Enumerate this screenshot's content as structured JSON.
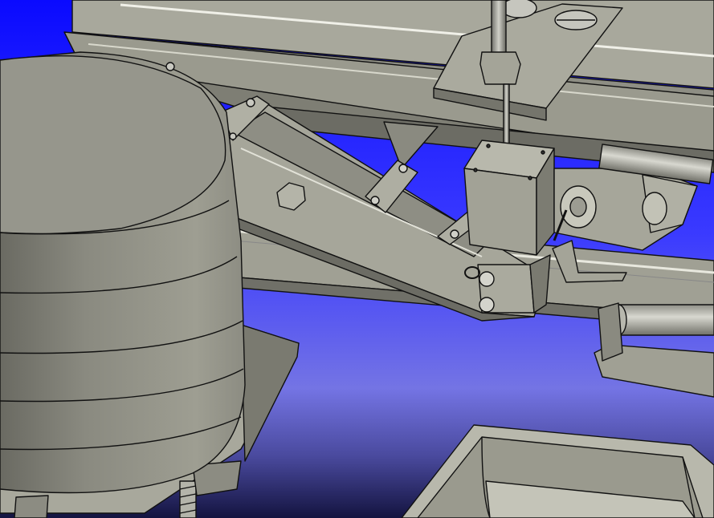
{
  "viewport": {
    "description_free": true,
    "colors": {
      "background_top": "#1010ff",
      "background_mid": "#7070e0",
      "background_bottom": "#1a1a50",
      "metal_light": "#b4b4a8",
      "metal": "#a2a296",
      "metal_dark": "#7c7c72",
      "metal_shadow": "#5e5e56",
      "edge": "#111111"
    }
  }
}
